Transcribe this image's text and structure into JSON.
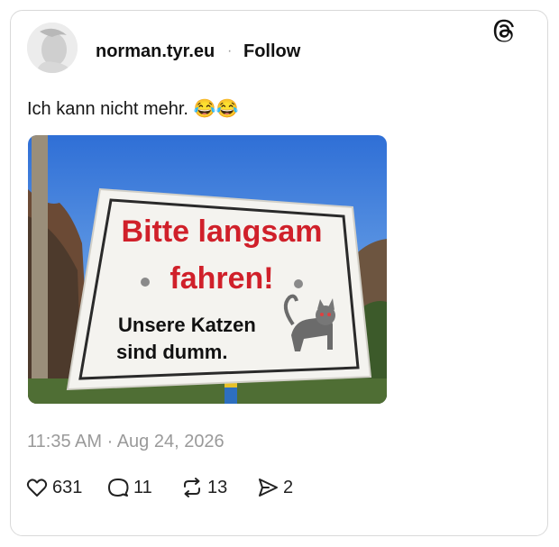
{
  "post": {
    "username": "norman.tyr.eu",
    "separator": "·",
    "follow_label": "Follow",
    "text": "Ich kann nicht mehr. 😂😂",
    "timestamp": "11:35 AM · Aug 24, 2026"
  },
  "image": {
    "sign_line1": "Bitte langsam",
    "sign_line2": "fahren!",
    "sign_line3": "Unsere Katzen",
    "sign_line4": "sind dumm."
  },
  "actions": {
    "likes": "631",
    "replies": "11",
    "reposts": "13",
    "shares": "2"
  },
  "icons": {
    "brand": "threads-logo-icon",
    "like": "heart-icon",
    "reply": "comment-icon",
    "repost": "repost-icon",
    "share": "send-icon"
  },
  "colors": {
    "sign_text_red": "#d0202a",
    "sky": "#3f86e0",
    "meta_gray": "#9a9a9a"
  }
}
